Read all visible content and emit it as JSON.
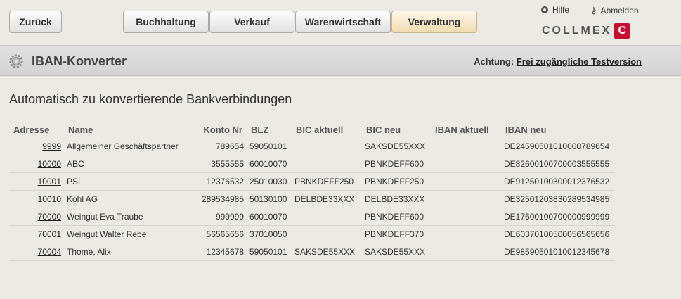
{
  "toolbar": {
    "back_label": "Zurück",
    "tabs": [
      {
        "label": "Buchhaltung",
        "active": false
      },
      {
        "label": "Verkauf",
        "active": false
      },
      {
        "label": "Warenwirtschaft",
        "active": false
      },
      {
        "label": "Verwaltung",
        "active": true
      }
    ],
    "help_label": "Hilfe",
    "logout_label": "Abmelden",
    "logo_text": "COLLMEX"
  },
  "titlebar": {
    "title": "IBAN-Konverter",
    "notice_prefix": "Achtung:",
    "notice_link": "Frei zugängliche Testversion"
  },
  "section": {
    "title": "Automatisch zu konvertierende Bankverbindungen"
  },
  "table": {
    "headers": [
      "Adresse",
      "Name",
      "Konto Nr",
      "BLZ",
      "BIC aktuell",
      "BIC neu",
      "IBAN aktuell",
      "IBAN neu"
    ],
    "rows": [
      [
        "9999",
        "Allgemeiner Geschäftspartner",
        "789654",
        "59050101",
        "",
        "SAKSDE55XXX",
        "",
        "DE24590501010000789654"
      ],
      [
        "10000",
        "ABC",
        "3555555",
        "60010070",
        "",
        "PBNKDEFF600",
        "",
        "DE82600100700003555555"
      ],
      [
        "10001",
        "PSL",
        "12376532",
        "25010030",
        "PBNKDEFF250",
        "PBNKDEFF250",
        "",
        "DE91250100300012376532"
      ],
      [
        "10010",
        "Kohl AG",
        "289534985",
        "50130100",
        "DELBDE33XXX",
        "DELBDE33XXX",
        "",
        "DE32501203830289534985"
      ],
      [
        "70000",
        "Weingut Eva Traube",
        "999999",
        "60010070",
        "",
        "PBNKDEFF600",
        "",
        "DE17600100700000999999"
      ],
      [
        "70001",
        "Weingut Walter Rebe",
        "56565656",
        "37010050",
        "",
        "PBNKDEFF370",
        "",
        "DE60370100500056565656"
      ],
      [
        "70004",
        "Thome, Alix",
        "12345678",
        "59050101",
        "SAKSDE55XXX",
        "SAKSDE55XXX",
        "",
        "DE98590501010012345678"
      ]
    ]
  },
  "colors": {
    "active_tab": "#f1dcb0",
    "logo_red": "#c8102e"
  }
}
